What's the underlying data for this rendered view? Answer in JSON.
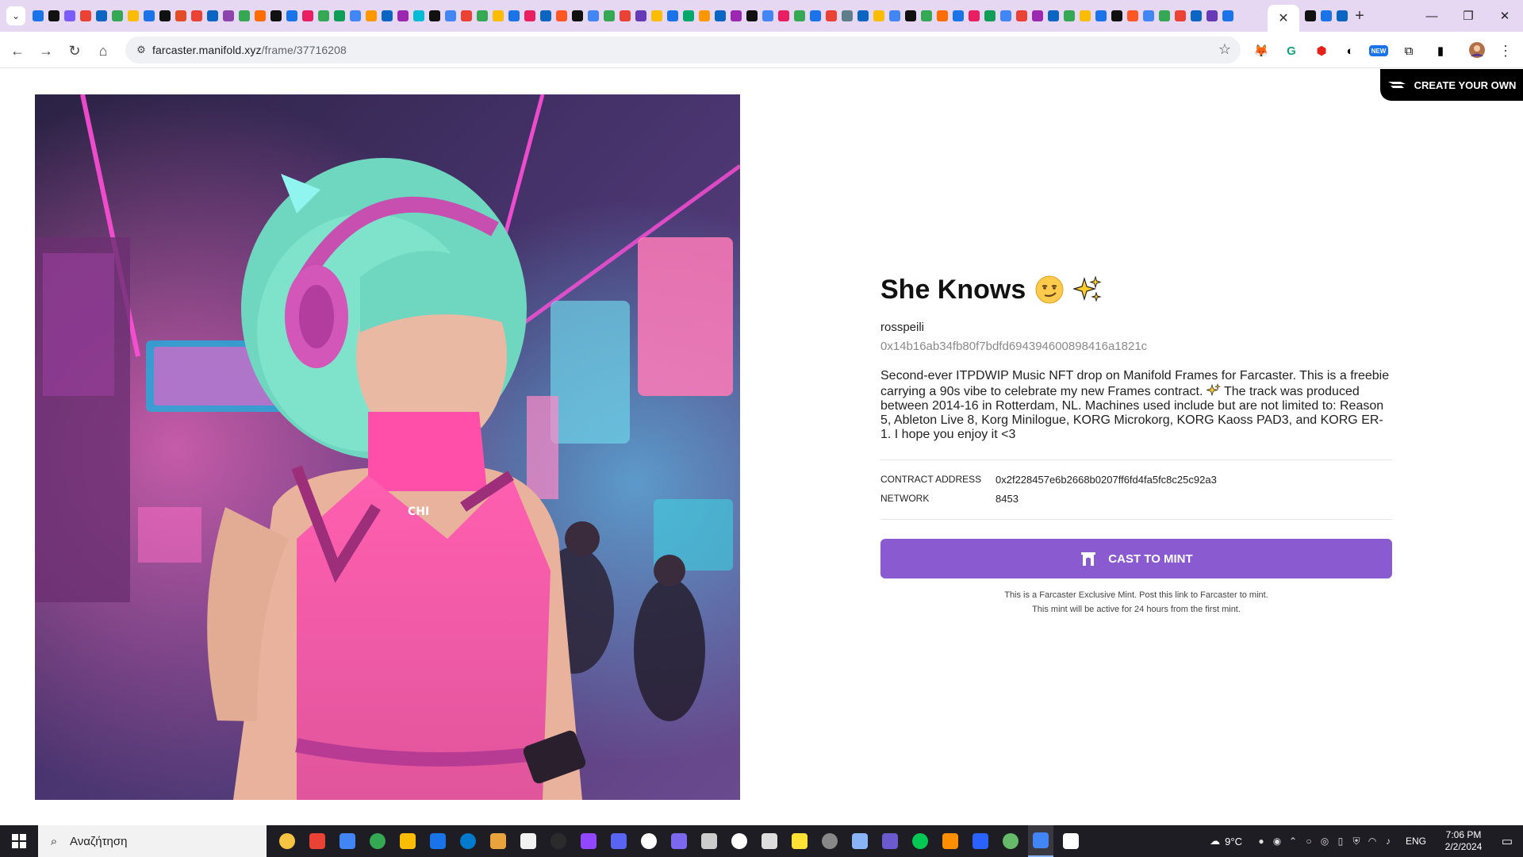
{
  "browser": {
    "url_host": "farcaster.manifold.xyz",
    "url_path": "/frame/37716208",
    "tab_favicons": [
      "#1a73e8",
      "#111111",
      "#7a5cff",
      "#ea4335",
      "#0a66c2",
      "#34a853",
      "#fbbc04",
      "#1a73e8",
      "#111111",
      "#e34c26",
      "#ea4335",
      "#0a66c2",
      "#8e44ad",
      "#34a853",
      "#ff6d00",
      "#111111",
      "#1a73e8",
      "#e91e63",
      "#34a853",
      "#0f9d58",
      "#4285f4",
      "#ff9800",
      "#0a66c2",
      "#9c27b0",
      "#00bcd4",
      "#111111",
      "#4285f4",
      "#ea4335",
      "#34a853",
      "#fbbc04",
      "#1a73e8",
      "#e91e63",
      "#0a66c2",
      "#ff5722",
      "#111111",
      "#4285f4",
      "#34a853",
      "#ea4335",
      "#673ab7",
      "#fbbc04",
      "#1a73e8",
      "#00a86b",
      "#ff9800",
      "#0a66c2",
      "#9c27b0",
      "#111111",
      "#4285f4",
      "#e91e63",
      "#34a853",
      "#1a73e8",
      "#ea4335",
      "#607d8b",
      "#0a66c2",
      "#fbbc04",
      "#4285f4",
      "#111111",
      "#34a853",
      "#ff6d00",
      "#1a73e8",
      "#e91e63",
      "#0f9d58",
      "#4285f4",
      "#ea4335",
      "#9c27b0",
      "#0a66c2",
      "#34a853",
      "#fbbc04",
      "#1a73e8",
      "#111111",
      "#ff5722",
      "#4285f4",
      "#34a853",
      "#ea4335",
      "#0a66c2",
      "#673ab7",
      "#1a73e8"
    ],
    "tab_favicons_right": [
      "#111111",
      "#1a73e8",
      "#0a66c2"
    ]
  },
  "extensions": [
    {
      "name": "metamask-icon",
      "glyph": "🦊"
    },
    {
      "name": "grammarly-icon",
      "glyph": "G"
    },
    {
      "name": "adblock-icon",
      "glyph": "⬢"
    },
    {
      "name": "dark-reader-icon",
      "glyph": "◐"
    },
    {
      "name": "new-extension-icon",
      "glyph": "NEW"
    },
    {
      "name": "puzzle-icon",
      "glyph": "⧉"
    },
    {
      "name": "sidepanel-icon",
      "glyph": "▮"
    }
  ],
  "page": {
    "create_button": "CREATE YOUR OWN",
    "nft": {
      "title": "She Knows",
      "creator": "rosspeili",
      "creator_address": "0x14b16ab34fb80f7bdfd694394600898416a1821c",
      "description_part1": "Second-ever ITPDWIP Music NFT drop on Manifold Frames for Farcaster. This is a freebie carrying a 90s vibe to celebrate my new Frames contract. ",
      "description_part2": " The track was produced between 2014-16 in Rotterdam, NL. Machines used include but are not limited to: Reason 5, Ableton Live 8, Korg Minilogue, KORG Microkorg, KORG Kaoss PAD3, and KORG ER-1. I hope you enjoy it <3",
      "contract_label": "CONTRACT ADDRESS",
      "contract_value": "0x2f228457e6b2668b0207ff6fd4fa5fc8c25c92a3",
      "network_label": "NETWORK",
      "network_value": "8453",
      "mint_button": "CAST TO MINT",
      "note_line1": "This is a Farcaster Exclusive Mint. Post this link to Farcaster to mint.",
      "note_line2": "This mint will be active for 24 hours from the first mint."
    }
  },
  "taskbar": {
    "search_placeholder": "Αναζήτηση",
    "apps": [
      "#f6c343",
      "#ea4335",
      "#4285f4",
      "#34a853",
      "#fbbc04",
      "#1a73e8",
      "#007acc",
      "#e8a33d",
      "#f1f1f1",
      "#2b2b2b",
      "#9146ff",
      "#5865f2",
      "#ffffff",
      "#7b68ee",
      "#cccccc",
      "#ffffff",
      "#dddddd",
      "#ffe135",
      "#888888",
      "#8ab4f8",
      "#6a5acd",
      "#00c853",
      "#ff8f00",
      "#2962ff",
      "#66bb6a",
      "#4285f4",
      "#ffffff"
    ],
    "weather_temp": "9°C",
    "language": "ENG",
    "time": "7:06 PM",
    "date": "2/2/2024"
  }
}
